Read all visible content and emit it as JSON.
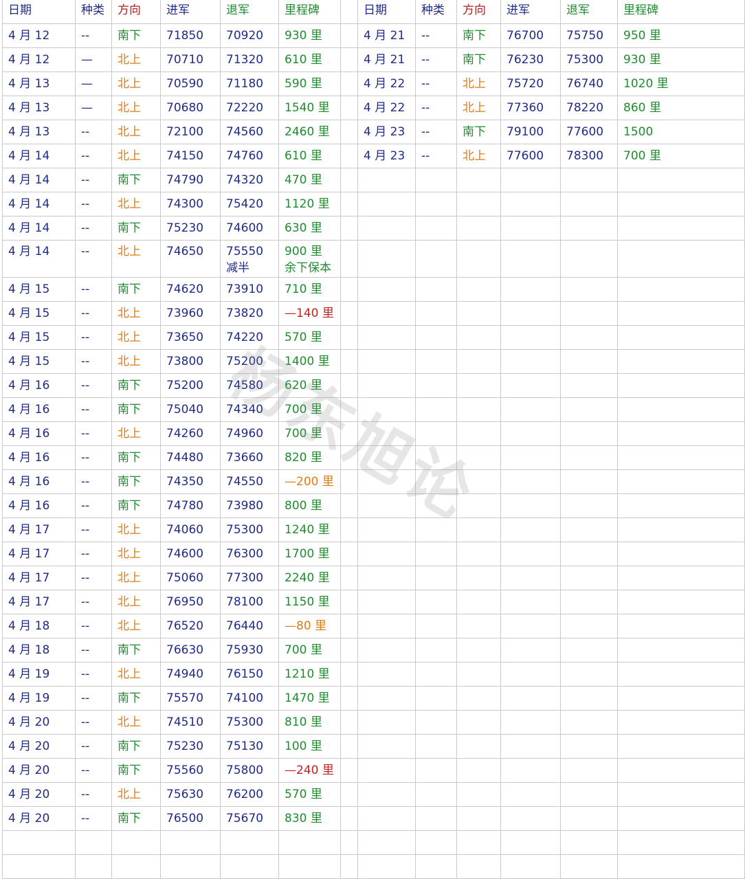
{
  "headers": [
    "日期",
    "种类",
    "方向",
    "进军",
    "退军",
    "里程碑",
    "日期",
    "种类",
    "方向",
    "进军",
    "退军",
    "里程碑"
  ],
  "colors": {
    "header_blue": "#1f2b86",
    "header_red": "#b11f1f",
    "green": "#1e8c2e",
    "orange": "#e07b14",
    "red": "#c81e1e",
    "grid": "#c9c9c9"
  },
  "left_rows": [
    [
      "4 月 12",
      "--",
      "南下",
      "71850",
      "70920",
      "930 里"
    ],
    [
      "4 月 12",
      "—",
      "北上",
      "70710",
      "71320",
      "610 里"
    ],
    [
      "4 月 13",
      "—",
      "北上",
      "70590",
      "71180",
      "590 里"
    ],
    [
      "4 月 13",
      "—",
      "北上",
      "70680",
      "72220",
      "1540 里"
    ],
    [
      "4 月 13",
      "--",
      "北上",
      "72100",
      "74560",
      "2460 里"
    ],
    [
      "4 月 14",
      "--",
      "北上",
      "74150",
      "74760",
      "610 里"
    ],
    [
      "4 月 14",
      "--",
      "南下",
      "74790",
      "74320",
      "470 里"
    ],
    [
      "4 月 14",
      "--",
      "北上",
      "74300",
      "75420",
      "1120 里"
    ],
    [
      "4 月 14",
      "--",
      "南下",
      "75230",
      "74600",
      "630 里"
    ],
    [
      "4 月 14",
      "--",
      "北上",
      "74650",
      "75550\n减半",
      "900 里\n余下保本"
    ],
    [
      "4 月 15",
      "--",
      "南下",
      "74620",
      "73910",
      "710 里"
    ],
    [
      "4 月 15",
      "--",
      "北上",
      "73960",
      "73820",
      "—140 里"
    ],
    [
      "4 月 15",
      "--",
      "北上",
      "73650",
      "74220",
      "570 里"
    ],
    [
      "4 月 15",
      "--",
      "北上",
      "73800",
      "75200",
      "1400 里"
    ],
    [
      "4 月 16",
      "--",
      "南下",
      "75200",
      "74580",
      "620 里"
    ],
    [
      "4 月 16",
      "--",
      "南下",
      "75040",
      "74340",
      "700 里"
    ],
    [
      "4 月 16",
      "--",
      "北上",
      "74260",
      "74960",
      "700 里"
    ],
    [
      "4 月 16",
      "--",
      "南下",
      "74480",
      "73660",
      "820 里"
    ],
    [
      "4 月 16",
      "--",
      "南下",
      "74350",
      "74550",
      "—200 里"
    ],
    [
      "4 月 16",
      "--",
      "南下",
      "74780",
      "73980",
      "800 里"
    ],
    [
      "4 月 17",
      "--",
      "北上",
      "74060",
      "75300",
      "1240 里"
    ],
    [
      "4 月 17",
      "--",
      "北上",
      "74600",
      "76300",
      "1700 里"
    ],
    [
      "4 月 17",
      "--",
      "北上",
      "75060",
      "77300",
      "2240 里"
    ],
    [
      "4 月 17",
      "--",
      "北上",
      "76950",
      "78100",
      "1150 里"
    ],
    [
      "4 月 18",
      "--",
      "北上",
      "76520",
      "76440",
      "—80 里"
    ],
    [
      "4 月 18",
      "--",
      "南下",
      "76630",
      "75930",
      "700 里"
    ],
    [
      "4 月 19",
      "--",
      "北上",
      "74940",
      "76150",
      "1210 里"
    ],
    [
      "4 月 19",
      "--",
      "南下",
      "75570",
      "74100",
      "1470 里"
    ],
    [
      "4 月 20",
      "--",
      "北上",
      "74510",
      "75300",
      "810 里"
    ],
    [
      "4 月 20",
      "--",
      "南下",
      "75230",
      "75130",
      "100 里"
    ],
    [
      "4 月 20",
      "--",
      "南下",
      "75560",
      "75800",
      "—240 里"
    ],
    [
      "4 月 20",
      "--",
      "北上",
      "75630",
      "76200",
      "570 里"
    ],
    [
      "4 月 20",
      "--",
      "南下",
      "76500",
      "75670",
      "830 里"
    ]
  ],
  "right_rows": [
    [
      "4 月 21",
      "--",
      "南下",
      "76700",
      "75750",
      "950 里"
    ],
    [
      "4 月 21",
      "--",
      "南下",
      "76230",
      "75300",
      "930 里"
    ],
    [
      "4 月 22",
      "--",
      "北上",
      "75720",
      "76740",
      "1020 里"
    ],
    [
      "4 月 22",
      "--",
      "北上",
      "77360",
      "78220",
      "860 里"
    ],
    [
      "4 月 23",
      "--",
      "南下",
      "79100",
      "77600",
      "1500"
    ],
    [
      "4 月 23",
      "--",
      "北上",
      "77600",
      "78300",
      "700 里"
    ]
  ],
  "milestone_colors_left": [
    "green",
    "green",
    "green",
    "green",
    "green",
    "green",
    "green",
    "green",
    "green",
    "green",
    "green",
    "red",
    "green",
    "green",
    "green",
    "green",
    "green",
    "green",
    "orange",
    "green",
    "green",
    "green",
    "green",
    "green",
    "orange",
    "green",
    "green",
    "green",
    "green",
    "green",
    "red",
    "green",
    "green"
  ],
  "watermark": "杨东旭论"
}
